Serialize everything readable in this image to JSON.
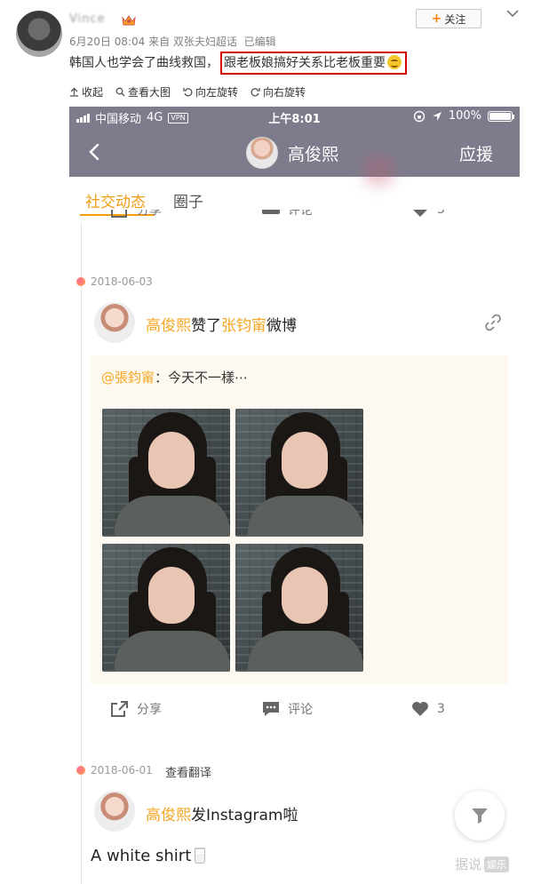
{
  "post": {
    "username": "Vince",
    "meta": "6月20日 08:04 来自 双张夫妇超话",
    "edited": "已编辑",
    "follow_label": "关注",
    "text_plain": "韩国人也学会了曲线救国，",
    "text_highlight": "跟老板娘搞好关系比老板重要"
  },
  "toolbar": {
    "items": [
      "收起",
      "查看大图",
      "向左旋转",
      "向右旋转"
    ]
  },
  "phone": {
    "carrier": "中国移动",
    "network": "4G",
    "vpn": "VPN",
    "time": "上午8:01",
    "battery": "100%",
    "title": "高俊熙",
    "right_action": "应援",
    "tabs": [
      "社交动态",
      "圈子"
    ],
    "actions_top": {
      "share": "分享",
      "comment": "评论",
      "likes": "3"
    },
    "feed1": {
      "date": "2018-06-03",
      "actor": "高俊熙",
      "verb": "赞了",
      "target": "张钧甯",
      "suffix": "微博",
      "quote_mention": "@張鈞甯",
      "quote_text": "：今天不一樣⋯",
      "actions": {
        "share": "分享",
        "comment": "评论",
        "likes": "3"
      }
    },
    "feed2": {
      "date": "2018-06-01",
      "translate": "查看翻译",
      "actor": "高俊熙",
      "suffix": "发Instagram啦",
      "caption": "A white shirt"
    }
  },
  "watermark": {
    "text": "据说",
    "badge": "娱乐"
  },
  "colors": {
    "accent": "#f5a623",
    "header": "#7d7c8c",
    "highlight_border": "#d40000",
    "follow_plus": "#ff8200"
  }
}
